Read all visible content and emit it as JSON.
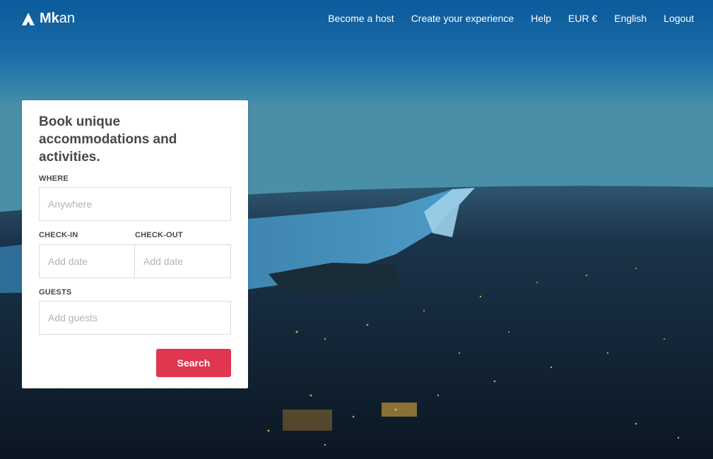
{
  "nav": {
    "logo_bold": "Mk",
    "logo_light": "an",
    "links": [
      {
        "label": "Become a host"
      },
      {
        "label": "Create your experience"
      },
      {
        "label": "Help"
      },
      {
        "label": "EUR €"
      },
      {
        "label": "English"
      },
      {
        "label": "Logout"
      }
    ]
  },
  "search_card": {
    "title": "Book unique accommodations and activities.",
    "where": {
      "label": "WHERE",
      "placeholder": "Anywhere"
    },
    "check_in": {
      "label": "CHECK-IN",
      "placeholder": "Add date"
    },
    "check_out": {
      "label": "CHECK-OUT",
      "placeholder": "Add date"
    },
    "guests": {
      "label": "GUESTS",
      "placeholder": "Add guests"
    },
    "search_label": "Search"
  },
  "colors": {
    "accent": "#e0364f",
    "label_text": "#484848",
    "placeholder_text": "#b3b3b3"
  },
  "icons": {
    "logo": "tent-logo-icon"
  }
}
